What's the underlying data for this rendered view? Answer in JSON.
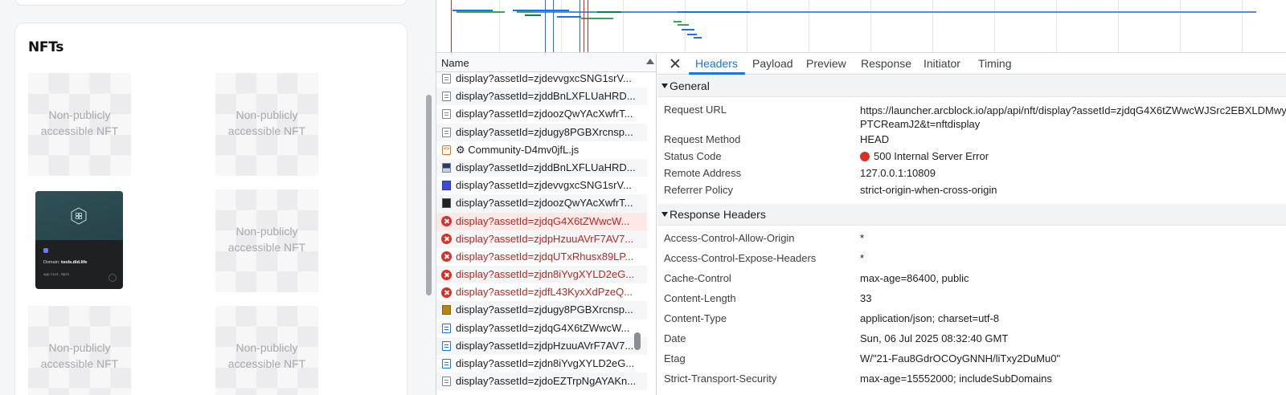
{
  "nft_panel": {
    "title": "NFTs",
    "tiles": [
      {
        "label": "Non-publicly accessible NFT"
      },
      {
        "label": "Non-publicly accessible NFT"
      },
      {
        "label": "Non-publicly accessible NFT"
      },
      {
        "label": "Non-publicly accessible NFT"
      },
      {
        "label": "Non-publicly accessible NFT"
      }
    ],
    "did_card": {
      "domain_label": "Domain:",
      "domain_value": "tools.did.life",
      "meta": "app  z1o4...8p21"
    }
  },
  "network": {
    "name_header": "Name",
    "requests": [
      {
        "name": "display?assetId=zjdevvgxcSNG1srV...",
        "icon": "doc",
        "status": "ok"
      },
      {
        "name": "display?assetId=zjddBnLXFLUaHRD...",
        "icon": "doc",
        "status": "ok"
      },
      {
        "name": "display?assetId=zjdoozQwYAcXwfrT...",
        "icon": "doc",
        "status": "ok"
      },
      {
        "name": "display?assetId=zjdugy8PGBXrcnsp...",
        "icon": "doc",
        "status": "ok"
      },
      {
        "name": "⚙ Community-D4mv0jfL.js",
        "icon": "js",
        "status": "ok"
      },
      {
        "name": "display?assetId=zjddBnLXFLUaHRD...",
        "icon": "img1",
        "status": "ok"
      },
      {
        "name": "display?assetId=zjdevvgxcSNG1srV...",
        "icon": "img2",
        "status": "ok"
      },
      {
        "name": "display?assetId=zjdoozQwYAcXwfrT...",
        "icon": "img3",
        "status": "ok"
      },
      {
        "name": "display?assetId=zjdqG4X6tZWwcW...",
        "icon": "errc",
        "status": "error"
      },
      {
        "name": "display?assetId=zjdpHzuuAVrF7AV7...",
        "icon": "errc",
        "status": "error"
      },
      {
        "name": "display?assetId=zjdqUTxRhusx89LP...",
        "icon": "errc",
        "status": "error"
      },
      {
        "name": "display?assetId=zjdn8iYvgXYLD2eG...",
        "icon": "errc",
        "status": "error"
      },
      {
        "name": "display?assetId=zjdfL43KyxXdPzeQ...",
        "icon": "errc",
        "status": "error"
      },
      {
        "name": "display?assetId=zjdugy8PGBXrcnsp...",
        "icon": "img4",
        "status": "ok"
      },
      {
        "name": "display?assetId=zjdqG4X6tZWwcW...",
        "icon": "docb",
        "status": "ok"
      },
      {
        "name": "display?assetId=zjdpHzuuAVrF7AV7...",
        "icon": "docb",
        "status": "ok"
      },
      {
        "name": "display?assetId=zjdn8iYvgXYLD2eG...",
        "icon": "docb",
        "status": "ok"
      },
      {
        "name": "display?assetId=zjdoEZTrpNgAYAKn...",
        "icon": "doc",
        "status": "ok"
      }
    ],
    "tabs": [
      "Headers",
      "Payload",
      "Preview",
      "Response",
      "Initiator",
      "Timing"
    ],
    "active_tab": "Headers",
    "general": {
      "title": "General",
      "rows": [
        {
          "key": "Request URL",
          "value": "https://launcher.arcblock.io/app/api/nft/display?assetId=zjdqG4X6tZWwcWJSrc2EBXLDMwyPTCReamJ2&t=nftdisplay"
        },
        {
          "key": "Request Method",
          "value": "HEAD"
        },
        {
          "key": "Status Code",
          "value": "500 Internal Server Error"
        },
        {
          "key": "Remote Address",
          "value": "127.0.0.1:10809"
        },
        {
          "key": "Referrer Policy",
          "value": "strict-origin-when-cross-origin"
        }
      ]
    },
    "response_headers": {
      "title": "Response Headers",
      "rows": [
        {
          "key": "Access-Control-Allow-Origin",
          "value": "*"
        },
        {
          "key": "Access-Control-Expose-Headers",
          "value": "*"
        },
        {
          "key": "Cache-Control",
          "value": "max-age=86400, public"
        },
        {
          "key": "Content-Length",
          "value": "33"
        },
        {
          "key": "Content-Type",
          "value": "application/json; charset=utf-8"
        },
        {
          "key": "Date",
          "value": "Sun, 06 Jul 2025 08:32:40 GMT"
        },
        {
          "key": "Etag",
          "value": "W/\"21-Fau8GdrOCOyGNNH/liTxy2DuMu0\""
        },
        {
          "key": "Strict-Transport-Security",
          "value": "max-age=15552000; includeSubDomains"
        }
      ]
    },
    "colors": {
      "accent": "#1a73e8",
      "error": "#d93025",
      "error_text": "#c5221f"
    }
  }
}
